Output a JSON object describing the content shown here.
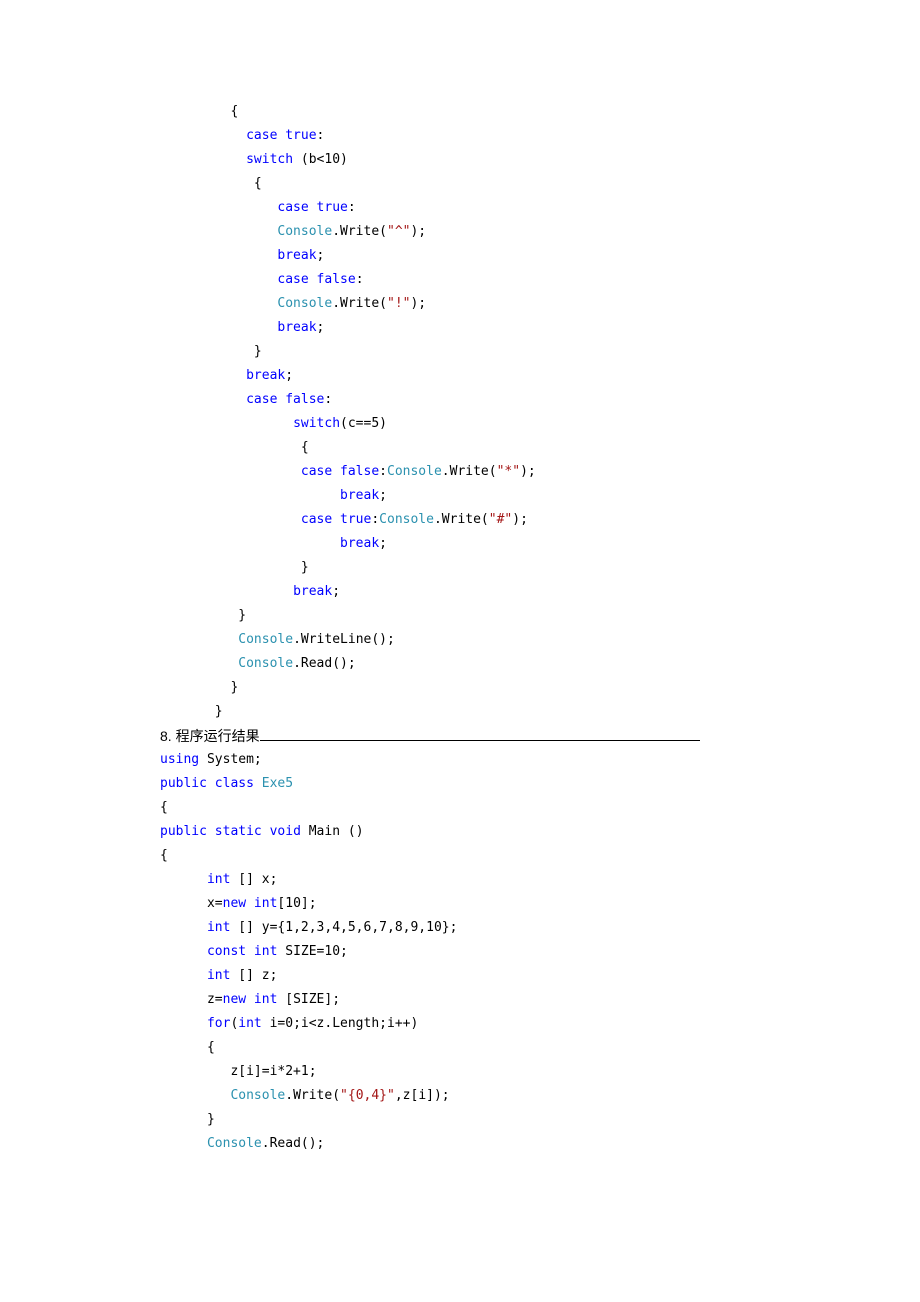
{
  "code1": {
    "l1": "         {",
    "l2": "           ",
    "kw_case2": "case",
    "txt_true2": " ",
    "kw_true2": "true",
    "col2": ":",
    "l3": "           ",
    "kw_switch3": "switch",
    "txt3": " (b<10)",
    "l4": "            {",
    "l5": "               ",
    "kw_case5": "case",
    "sp5": " ",
    "kw_true5": "true",
    "col5": ":",
    "l6": "               ",
    "cls6": "Console",
    "txt6a": ".Write(",
    "str6": "\"^\"",
    "txt6b": ");",
    "l7": "               ",
    "kw_break7": "break",
    "sc7": ";",
    "l8": "               ",
    "kw_case8": "case",
    "sp8": " ",
    "kw_false8": "false",
    "col8": ":",
    "l9": "               ",
    "cls9": "Console",
    "txt9a": ".Write(",
    "str9": "\"!\"",
    "txt9b": ");",
    "l10": "               ",
    "kw_break10": "break",
    "sc10": ";",
    "l11": "            }",
    "l12": "           ",
    "kw_break12": "break",
    "sc12": ";",
    "l13": "           ",
    "kw_case13": "case",
    "sp13": " ",
    "kw_false13": "false",
    "col13": ":",
    "l14": "                 ",
    "kw_switch14": "switch",
    "txt14": "(c==5)",
    "l15": "                  {",
    "l16": "                  ",
    "kw_case16": "case",
    "sp16": " ",
    "kw_false16": "false",
    "col16": ":",
    "cls16": "Console",
    "txt16a": ".Write(",
    "str16": "\"*\"",
    "txt16b": ");",
    "l17": "                       ",
    "kw_break17": "break",
    "sc17": ";",
    "l18": "                  ",
    "kw_case18": "case",
    "sp18": " ",
    "kw_true18": "true",
    "col18": ":",
    "cls18": "Console",
    "txt18a": ".Write(",
    "str18": "\"#\"",
    "txt18b": ");",
    "l19": "                       ",
    "kw_break19": "break",
    "sc19": ";",
    "l20": "                  }",
    "l21": "                 ",
    "kw_break21": "break",
    "sc21": ";",
    "l22": "          }",
    "l23": "          ",
    "cls23": "Console",
    "txt23": ".WriteLine();",
    "l24": "          ",
    "cls24": "Console",
    "txt24": ".Read();",
    "l25": "         }",
    "l26": "       }"
  },
  "question": {
    "num": "8.",
    "text": " 程序运行结果"
  },
  "code2": {
    "kw_using": "using",
    "txt_using": " System;",
    "kw_public1": "public",
    "kw_class": " class",
    "cls_exe5": " Exe5",
    "lbrace1": "{",
    "kw_public2": "public",
    "kw_static": " static",
    "kw_void": " void",
    "txt_main": " Main ()",
    "lbrace2": "{",
    "ind": "      ",
    "kw_int1": "int",
    "txt_x": " [] x;",
    "txt_xnew": "      x=",
    "kw_new1": "new",
    "kw_int1b": " int",
    "txt_xnew2": "[10];",
    "kw_int2": "int",
    "txt_y": " [] y={1,2,3,4,5,6,7,8,9,10};",
    "kw_const": "const",
    "kw_int3": " int",
    "txt_size": " SIZE=10;",
    "kw_int4": "int",
    "txt_z": " [] z;",
    "txt_znew": "      z=",
    "kw_new2": "new",
    "kw_int4b": " int",
    "txt_znew2": " [SIZE];",
    "kw_for": "for",
    "txt_for1": "(",
    "kw_int5": "int",
    "txt_for2": " i=0;i<z.Length;i++)",
    "lbrace3": "      {",
    "txt_zi": "         z[i]=i*2+1;",
    "ind2": "         ",
    "cls_con": "Console",
    "txt_w1": ".Write(",
    "str_fmt": "\"{0,4}\"",
    "txt_w2": ",z[i]);",
    "rbrace3": "      }",
    "cls_con2": "Console",
    "txt_read": ".Read();"
  }
}
